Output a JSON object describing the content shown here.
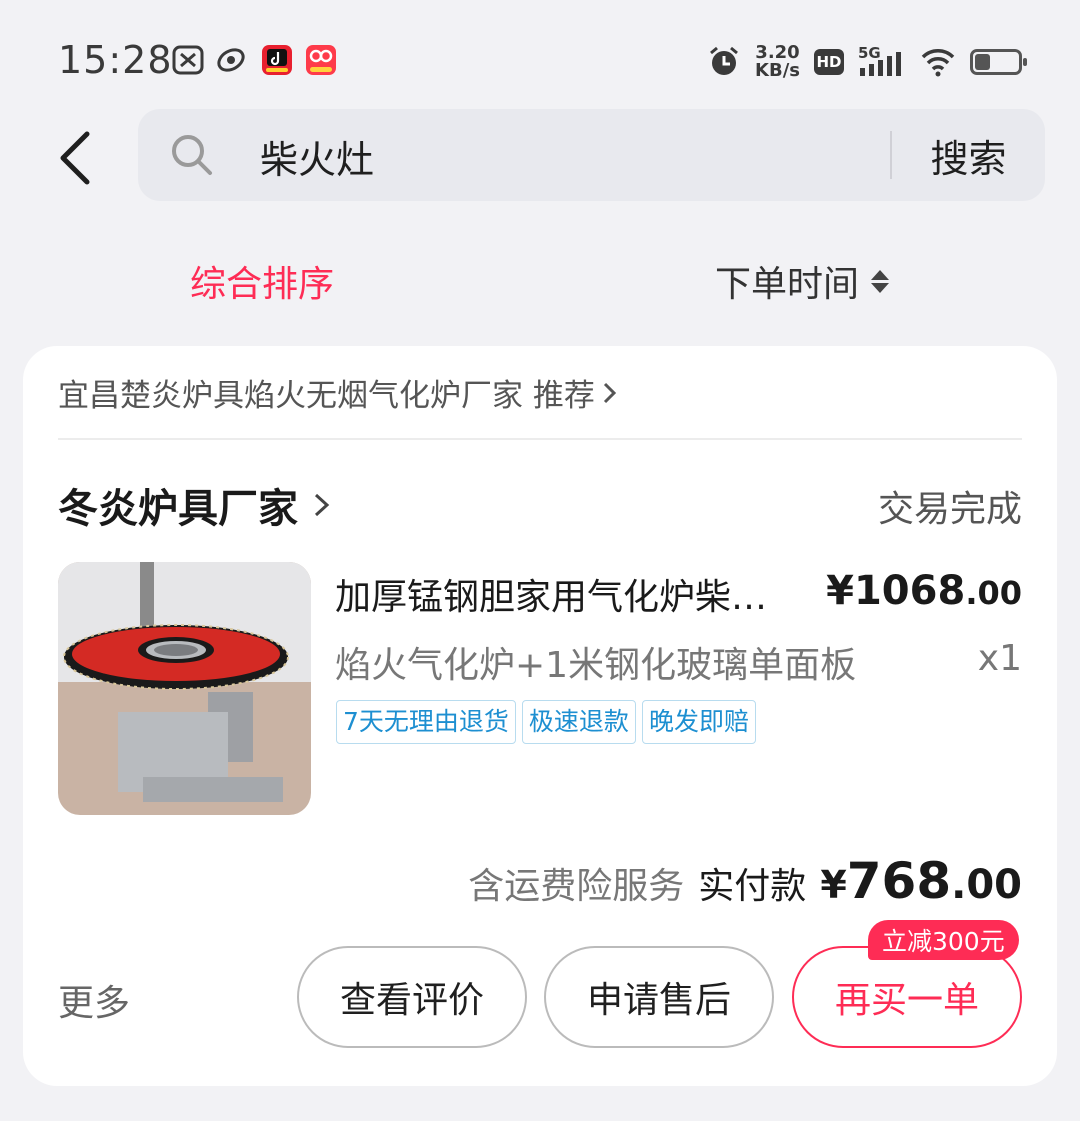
{
  "status_bar": {
    "time": "15:28",
    "net_speed_value": "3.20",
    "net_speed_unit": "KB/s",
    "hd_label": "HD",
    "network_label": "5G",
    "battery_level": 0.35
  },
  "search": {
    "query": "柴火灶",
    "button_label": "搜索"
  },
  "sort_tabs": {
    "comprehensive": "综合排序",
    "order_time": "下单时间"
  },
  "order": {
    "recommend_text": "宜昌楚炎炉具焰火无烟气化炉厂家 推荐",
    "shop_name": "冬炎炉具厂家",
    "status": "交易完成",
    "product": {
      "title": "加厚锰钢胆家用气化炉柴火灶",
      "price_main": "¥1068",
      "price_cents": ".00",
      "spec": "焰火气化炉+1米钢化玻璃单面板",
      "quantity": "x1",
      "tags": [
        "7天无理由退货",
        "极速退款",
        "晚发即赔"
      ]
    },
    "payment": {
      "note": "含运费险服务",
      "label": "实付款",
      "currency": "¥",
      "amount_main": "768",
      "amount_cents": ".00"
    },
    "actions": {
      "more": "更多",
      "review": "查看评价",
      "after_sale": "申请售后",
      "rebuy": "再买一单",
      "discount_badge": "立减300元"
    }
  },
  "colors": {
    "accent": "#fe2c55",
    "tag_blue": "#1d8fd1",
    "background": "#f2f2f5"
  }
}
